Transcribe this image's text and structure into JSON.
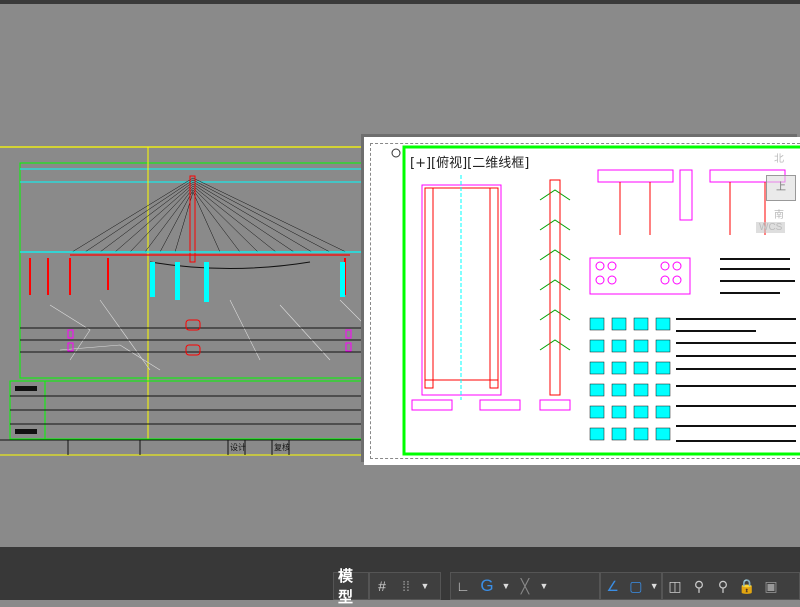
{
  "viewport": {
    "label": "[+][俯视][二维线框]"
  },
  "viewcube": {
    "north": "北",
    "south": "南",
    "top_face": "上",
    "wcs": "WCS"
  },
  "title_block": {
    "design": "设计",
    "review": "复核"
  },
  "statusbar": {
    "model_tab": "模型",
    "icons": [
      "grid-icon",
      "snap-grid-icon",
      "dropdown",
      "ortho-icon",
      "polar-tracking-icon",
      "dropdown",
      "isometric-icon",
      "dropdown",
      "object-snap-tracking-icon",
      "object-snap-icon",
      "dropdown",
      "viewport-scale-icon",
      "annotation-visibility-icon",
      "auto-scale-icon",
      "lock-ui-icon",
      "isolate-objects-icon"
    ]
  },
  "colors": {
    "canvas": "#8a8a8a",
    "statusbar": "#383838",
    "frame_green": "#00ff00",
    "cable_red": "#ff0000",
    "cyan": "#00ffff",
    "magenta": "#ff00ff",
    "yellow": "#ffff00",
    "accent_blue": "#3a8ee6"
  }
}
